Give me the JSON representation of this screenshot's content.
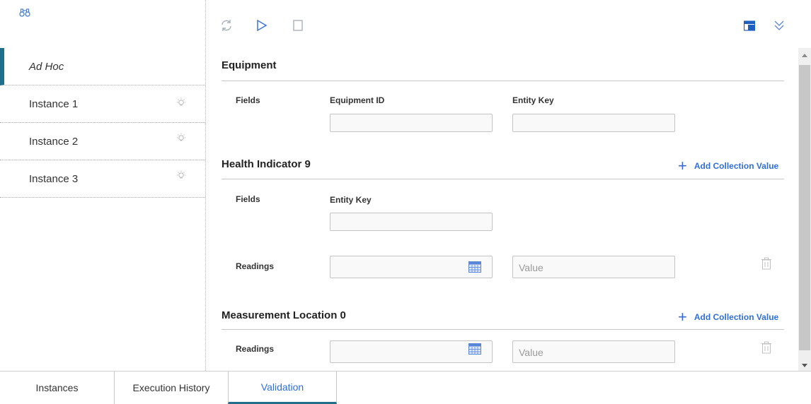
{
  "left_panel": {
    "instances": [
      {
        "label": "Ad Hoc",
        "active": true,
        "icon": ""
      },
      {
        "label": "Instance 1",
        "active": false,
        "icon": "lightbulb-icon"
      },
      {
        "label": "Instance 2",
        "active": false,
        "icon": "lightbulb-icon"
      },
      {
        "label": "Instance 3",
        "active": false,
        "icon": "lightbulb-icon"
      }
    ]
  },
  "toolbar": {
    "icons": [
      "refresh-icon",
      "play-icon",
      "stop-icon",
      "panel-layout-icon",
      "collapse-chevrons-icon"
    ]
  },
  "sections": {
    "equipment": {
      "title": "Equipment",
      "fields_label": "Fields",
      "col1_header": "Equipment ID",
      "col2_header": "Entity Key",
      "equipment_id_value": "",
      "entity_key_value": ""
    },
    "health_indicator": {
      "title": "Health Indicator 9",
      "add_label": "Add Collection Value",
      "fields_label": "Fields",
      "col1_header": "Entity Key",
      "entity_key_value": "",
      "readings_label": "Readings",
      "date_value": "",
      "value_placeholder": "Value"
    },
    "measurement_location": {
      "title": "Measurement Location 0",
      "add_label": "Add Collection Value",
      "readings_label": "Readings",
      "date_value": "",
      "value_placeholder": "Value"
    }
  },
  "tabs": [
    {
      "label": "Instances",
      "active": false
    },
    {
      "label": "Execution History",
      "active": false
    },
    {
      "label": "Validation",
      "active": true
    }
  ],
  "colors": {
    "accent": "#2f6fd6",
    "active_marker": "#1f6f8b",
    "icon_gray": "#9aa3ad"
  }
}
